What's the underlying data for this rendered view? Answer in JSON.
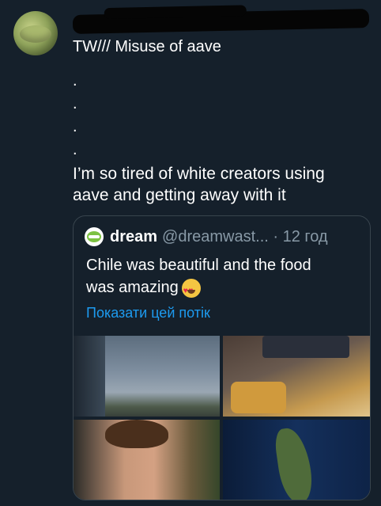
{
  "tweet": {
    "headline": "TW/// Misuse of aave",
    "dots": [
      ".",
      ".",
      ".",
      "."
    ],
    "body_line1": "I’m so tired of white creators using",
    "body_line2": "aave and getting away with it"
  },
  "quote": {
    "name": "dream",
    "handle_time": "@dreamwast... · 12 год",
    "text_line1": "Chile was beautiful and the food",
    "text_line2": "was amazing",
    "emoji": "heart-eyes-emoji",
    "show_thread": "Показати цей потік"
  },
  "colors": {
    "background": "#15202b",
    "link": "#1d9bf0",
    "muted": "#8899a6",
    "border": "#38444d"
  }
}
